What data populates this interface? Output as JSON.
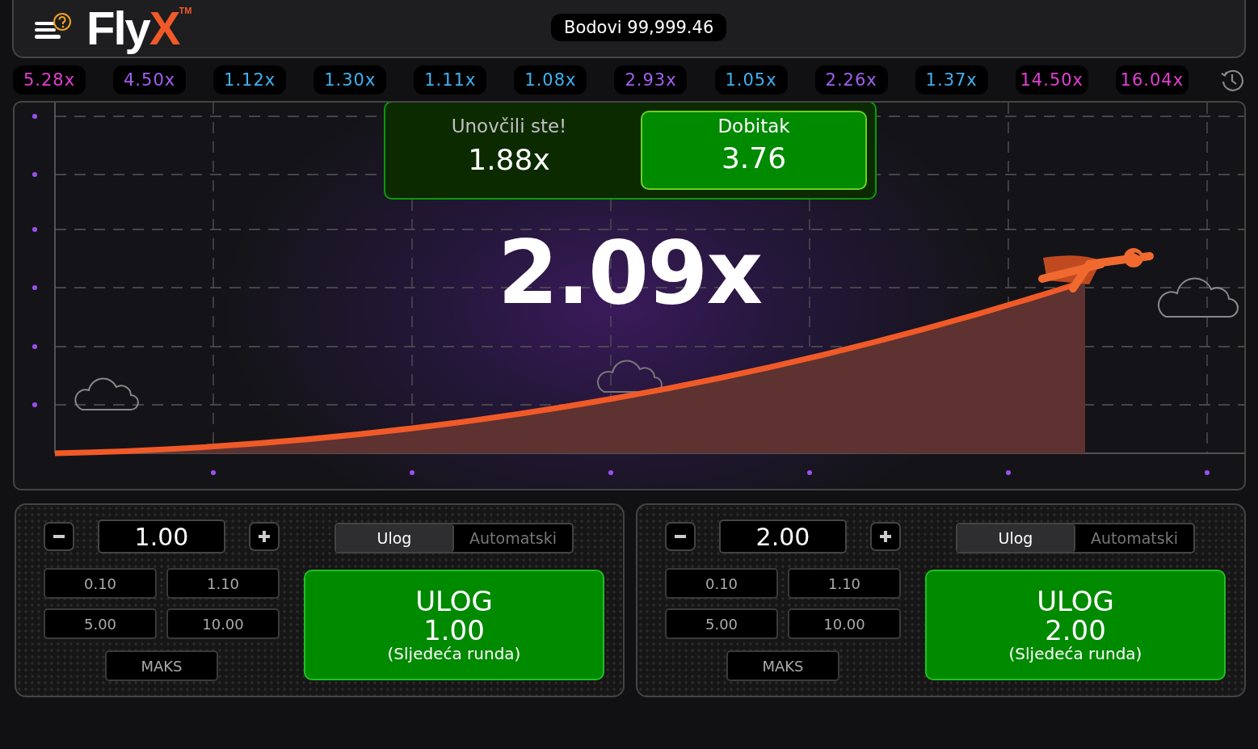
{
  "header": {
    "logo": {
      "text": "Fly",
      "accent": "X",
      "mark": "TM"
    },
    "balance": "Bodovi 99,999.46"
  },
  "history": [
    {
      "value": "5.28x",
      "color": "#e040d0"
    },
    {
      "value": "4.50x",
      "color": "#a060f0"
    },
    {
      "value": "1.12x",
      "color": "#40b0f0"
    },
    {
      "value": "1.30x",
      "color": "#40b0f0"
    },
    {
      "value": "1.11x",
      "color": "#40b0f0"
    },
    {
      "value": "1.08x",
      "color": "#40b0f0"
    },
    {
      "value": "2.93x",
      "color": "#a060f0"
    },
    {
      "value": "1.05x",
      "color": "#40b0f0"
    },
    {
      "value": "2.26x",
      "color": "#a060f0"
    },
    {
      "value": "1.37x",
      "color": "#40b0f0"
    },
    {
      "value": "14.50x",
      "color": "#e040d0"
    },
    {
      "value": "16.04x",
      "color": "#e040d0"
    }
  ],
  "game": {
    "multiplier": "2.09x",
    "cashout": {
      "label": "Unovčili ste!",
      "multiplier": "1.88x",
      "win_label": "Dobitak",
      "win_amount": "3.76"
    }
  },
  "bet_panels": [
    {
      "stake": "1.00",
      "quick_amounts": [
        "0.10",
        "1.10",
        "5.00",
        "10.00"
      ],
      "max_label": "MAKS",
      "tabs": [
        {
          "label": "Ulog",
          "selected": true
        },
        {
          "label": "Automatski",
          "selected": false
        }
      ],
      "bet_button": {
        "title": "ULOG",
        "amount": "1.00",
        "note": "(Sljedeća runda)"
      }
    },
    {
      "stake": "2.00",
      "quick_amounts": [
        "0.10",
        "1.10",
        "5.00",
        "10.00"
      ],
      "max_label": "MAKS",
      "tabs": [
        {
          "label": "Ulog",
          "selected": true
        },
        {
          "label": "Automatski",
          "selected": false
        }
      ],
      "bet_button": {
        "title": "ULOG",
        "amount": "2.00",
        "note": "(Sljedeća runda)"
      }
    }
  ]
}
